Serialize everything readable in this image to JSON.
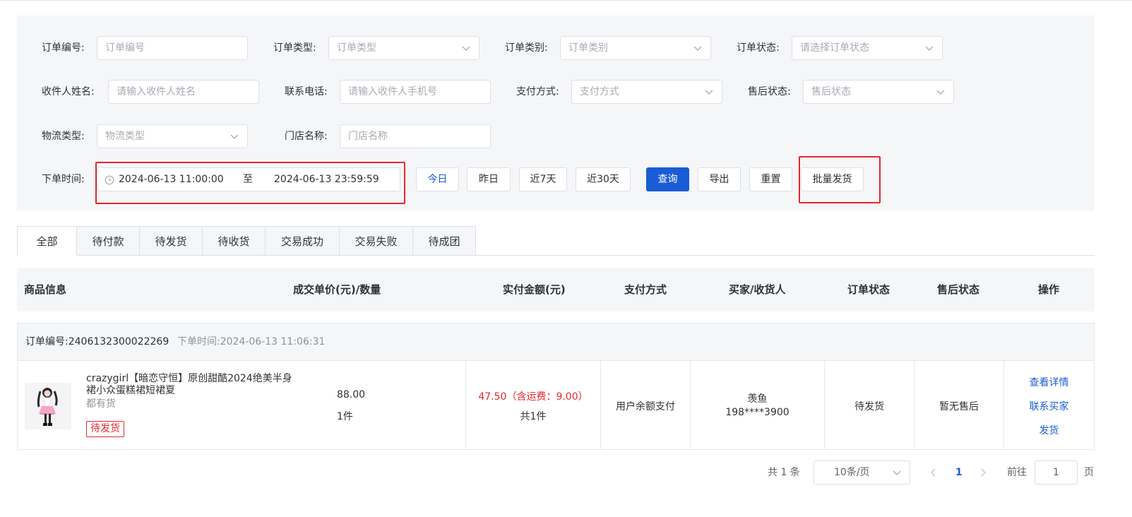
{
  "filters": {
    "order_no": {
      "label": "订单编号:",
      "placeholder": "订单编号"
    },
    "order_type": {
      "label": "订单类型:",
      "placeholder": "订单类型"
    },
    "order_category": {
      "label": "订单类别:",
      "placeholder": "订单类别"
    },
    "order_status": {
      "label": "订单状态:",
      "placeholder": "请选择订单状态"
    },
    "receiver_name": {
      "label": "收件人姓名:",
      "placeholder": "请输入收件人姓名"
    },
    "phone": {
      "label": "联系电话:",
      "placeholder": "请输入收件人手机号"
    },
    "payment": {
      "label": "支付方式:",
      "placeholder": "支付方式"
    },
    "after_sale": {
      "label": "售后状态:",
      "placeholder": "售后状态"
    },
    "logistics": {
      "label": "物流类型:",
      "placeholder": "物流类型"
    },
    "store": {
      "label": "门店名称:",
      "placeholder": "门店名称"
    },
    "order_time": {
      "label": "下单时间:",
      "start": "2024-06-13 11:00:00",
      "separator": "至",
      "end": "2024-06-13 23:59:59"
    }
  },
  "quick_buttons": {
    "today": "今日",
    "yesterday": "昨日",
    "last7": "近7天",
    "last30": "近30天"
  },
  "actions": {
    "query": "查询",
    "export": "导出",
    "reset": "重置",
    "batch_ship": "批量发货"
  },
  "tabs": [
    "全部",
    "待付款",
    "待发货",
    "待收货",
    "交易成功",
    "交易失败",
    "待成团"
  ],
  "table_headers": {
    "product": "商品信息",
    "unit_price_qty": "成交单价(元)/数量",
    "paid_amount": "实付金额(元)",
    "payment_method": "支付方式",
    "buyer": "买家/收货人",
    "order_status": "订单状态",
    "after_sale_status": "售后状态",
    "actions": "操作"
  },
  "order": {
    "order_no": "订单编号:2406132300022269",
    "order_time": "下单时间:2024-06-13 11:06:31",
    "product_title": "crazygirl【暗恋守恒】原创甜酷2024绝美半身裙小众蛋糕裙短裙夏",
    "product_sub": "都有货",
    "product_tag": "待发货",
    "unit_price": "88.00",
    "quantity": "1件",
    "paid": "47.50（含运费：9.00）",
    "paid_count": "共1件",
    "payment_method": "用户余额支付",
    "buyer_name": "羡鱼",
    "buyer_phone": "198****3900",
    "status": "待发货",
    "after_sale": "暂无售后",
    "action_detail": "查看详情",
    "action_contact": "联系买家",
    "action_ship": "发货"
  },
  "pagination": {
    "total": "共 1 条",
    "page_size": "10条/页",
    "current_page": "1",
    "goto_label": "前往",
    "goto_value": "1",
    "page_suffix": "页"
  },
  "colors": {
    "primary": "#1a5cd6",
    "danger": "#e8262b",
    "panel": "#f5f6f8"
  }
}
